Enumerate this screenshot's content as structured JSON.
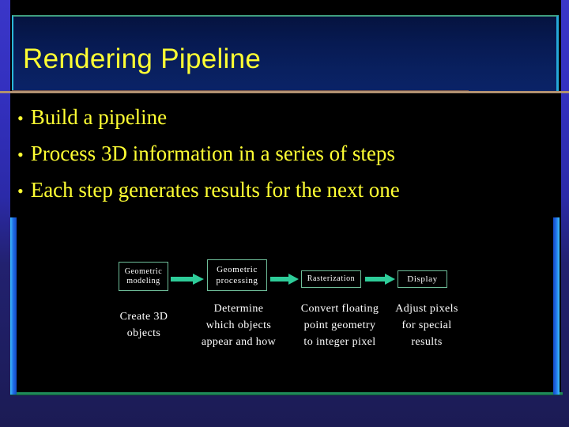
{
  "slide": {
    "title": "Rendering Pipeline",
    "bullets": [
      {
        "marker": "•",
        "text": "Build a pipeline"
      },
      {
        "marker": "•",
        "text": "Process 3D information in a series of steps"
      },
      {
        "marker": "•",
        "text": "Each step generates results for the next one"
      }
    ]
  },
  "diagram": {
    "name": "rendering-pipeline-diagram",
    "stages": [
      {
        "box_line1": "Geometric",
        "box_line2": "modeling",
        "caption_line1": "Create 3D",
        "caption_line2": "objects",
        "caption_line3": ""
      },
      {
        "box_line1": "Geometric",
        "box_line2": "processing",
        "caption_line1": "Determine",
        "caption_line2": "which objects",
        "caption_line3": "appear and how"
      },
      {
        "box_line1": "Rasterization",
        "box_line2": "",
        "caption_line1": "Convert floating",
        "caption_line2": "point geometry",
        "caption_line3": "to integer pixel"
      },
      {
        "box_line1": "Display",
        "box_line2": "",
        "caption_line1": "Adjust pixels",
        "caption_line2": "for special",
        "caption_line3": "results"
      }
    ],
    "arrows": [
      {
        "name": "arrow-modeling-to-processing"
      },
      {
        "name": "arrow-processing-to-rasterization"
      },
      {
        "name": "arrow-rasterization-to-display"
      }
    ]
  },
  "colors": {
    "title_text": "#ffff33",
    "bullet_text": "#ffff33",
    "body_background": "#000000",
    "slide_frame": "#2f2cc0",
    "title_panel": "#071a52",
    "box_border": "#6fbf9a",
    "arrow_fill": "#2ecc99",
    "caption_text": "#ffffff",
    "divider_rule": "#b09070",
    "accent_bar": "#2f8fe8"
  }
}
